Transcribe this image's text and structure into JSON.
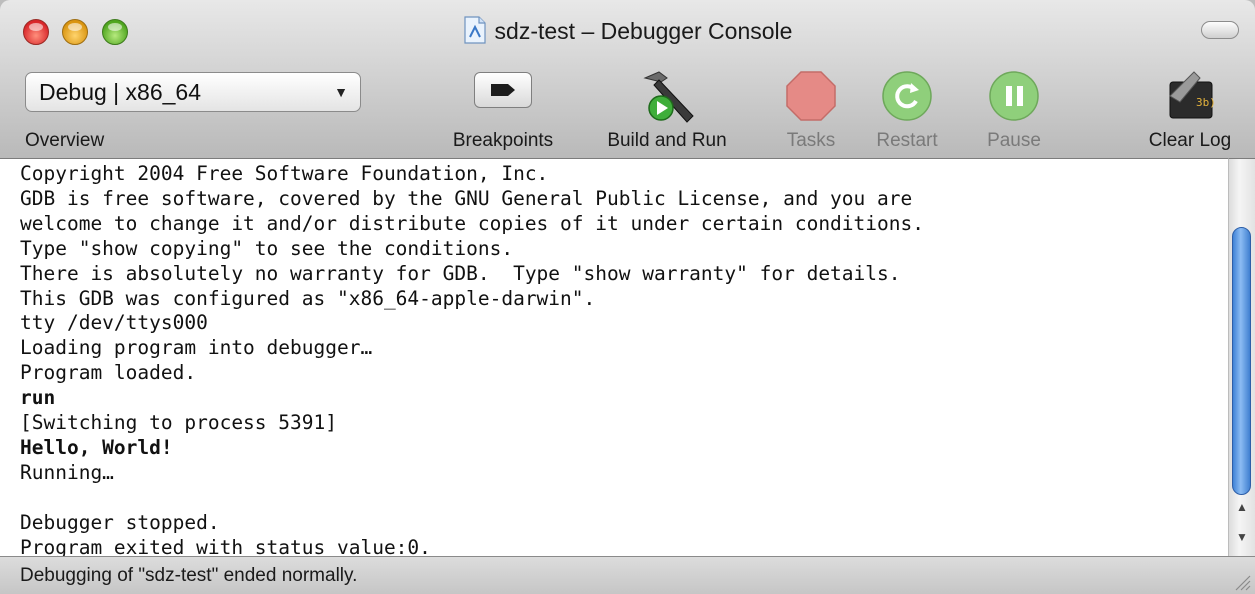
{
  "window": {
    "title": "sdz-test – Debugger Console",
    "document_icon": "xcode-document-icon"
  },
  "toolbar": {
    "overview": {
      "value": "Debug | x86_64",
      "label": "Overview"
    },
    "breakpoints": {
      "label": "Breakpoints",
      "icon": "breakpoint-arrow-icon"
    },
    "build_and_run": {
      "label": "Build and Run",
      "icon": "hammer-run-icon"
    },
    "tasks": {
      "label": "Tasks",
      "icon": "stop-octagon-icon",
      "enabled": false
    },
    "restart": {
      "label": "Restart",
      "icon": "restart-icon",
      "enabled": false
    },
    "pause": {
      "label": "Pause",
      "icon": "pause-icon",
      "enabled": false
    },
    "clear_log": {
      "label": "Clear Log",
      "icon": "clear-log-icon"
    }
  },
  "console": {
    "lines": [
      {
        "text": "Copyright 2004 Free Software Foundation, Inc.",
        "bold": false
      },
      {
        "text": "GDB is free software, covered by the GNU General Public License, and you are",
        "bold": false
      },
      {
        "text": "welcome to change it and/or distribute copies of it under certain conditions.",
        "bold": false
      },
      {
        "text": "Type \"show copying\" to see the conditions.",
        "bold": false
      },
      {
        "text": "There is absolutely no warranty for GDB.  Type \"show warranty\" for details.",
        "bold": false
      },
      {
        "text": "This GDB was configured as \"x86_64-apple-darwin\".",
        "bold": false
      },
      {
        "text": "tty /dev/ttys000",
        "bold": false
      },
      {
        "text": "Loading program into debugger…",
        "bold": false
      },
      {
        "text": "Program loaded.",
        "bold": false
      },
      {
        "text": "run",
        "bold": true
      },
      {
        "text": "[Switching to process 5391]",
        "bold": false
      },
      {
        "text": "Hello, World!",
        "bold": true
      },
      {
        "text": "Running…",
        "bold": false
      },
      {
        "text": "",
        "bold": false
      },
      {
        "text": "Debugger stopped.",
        "bold": false
      },
      {
        "text": "Program exited with status value:0.",
        "bold": false
      }
    ]
  },
  "status": {
    "text": "Debugging of \"sdz-test\" ended normally."
  },
  "colors": {
    "close": "#d8262a",
    "minimize": "#d99410",
    "zoom": "#4ea51f",
    "scroll_thumb": "#3f82d6",
    "tasks_stop": "#e0504c",
    "restart_pause_green": "#4caa2e"
  }
}
